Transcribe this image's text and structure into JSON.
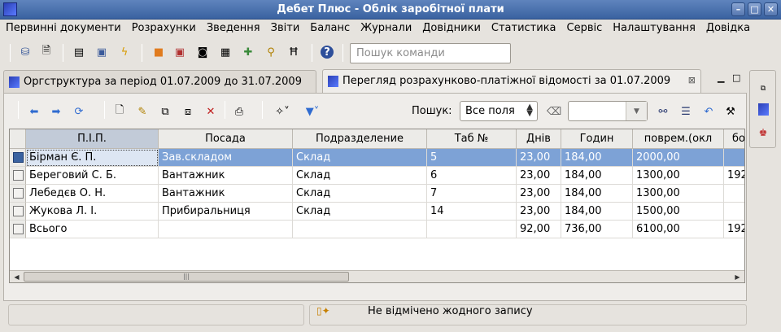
{
  "window": {
    "title": "Дебет Плюс - Облік заробітної плати",
    "controls": [
      "minimize-icon",
      "maximize-icon",
      "close-icon"
    ]
  },
  "menu": [
    "Первинні документи",
    "Розрахунки",
    "Зведення",
    "Звіти",
    "Баланс",
    "Журнали",
    "Довідники",
    "Статистика",
    "Сервіс",
    "Налаштування",
    "Довідка"
  ],
  "toolbar": {
    "command_search_placeholder": "Пошук команди",
    "icons": [
      "database-icon",
      "new-document-icon",
      "window-list-icon",
      "monitor-icon",
      "lightning-icon",
      "orange-square-icon",
      "person-card-icon",
      "camera-icon",
      "calendar-icon",
      "add-user-icon",
      "search-icon",
      "tools-icon",
      "help-icon"
    ]
  },
  "tabs": [
    {
      "label": "Оргструктура за період 01.07.2009 до 31.07.2009",
      "active": false
    },
    {
      "label": "Перегляд розрахунково-платіжної відомості за 01.07.2009",
      "active": true
    }
  ],
  "panel_toolbar": {
    "search_label": "Пошук:",
    "search_scope": "Все поля",
    "search_value": "",
    "icons": [
      "arrow-left-icon",
      "arrow-right-icon",
      "refresh-icon",
      "new-icon",
      "edit-icon",
      "copy-icon",
      "export-icon",
      "delete-icon",
      "print-icon",
      "wand-icon",
      "filter-icon",
      "eraser-icon",
      "binoculars-icon",
      "list-icon",
      "undo-icon",
      "hammer-icon"
    ]
  },
  "table": {
    "columns": [
      "П.І.П.",
      "Посада",
      "Подразделение",
      "Таб №",
      "Днів",
      "Годин",
      "поврем.(окл",
      "бо"
    ],
    "rows": [
      [
        "Бірман Є. П.",
        "Зав.складом",
        "Склад",
        "5",
        "23,00",
        "184,00",
        "2000,00",
        ""
      ],
      [
        "Береговий С. Б.",
        "Вантажник",
        "Склад",
        "6",
        "23,00",
        "184,00",
        "1300,00",
        "192"
      ],
      [
        "Лебедєв О. Н.",
        "Вантажник",
        "Склад",
        "7",
        "23,00",
        "184,00",
        "1300,00",
        ""
      ],
      [
        "Жукова Л. І.",
        "Прибиральниця",
        "Склад",
        "14",
        "23,00",
        "184,00",
        "1500,00",
        ""
      ],
      [
        "Всього",
        "",
        "",
        "",
        "92,00",
        "736,00",
        "6100,00",
        "192"
      ]
    ],
    "selected_row": 0
  },
  "status": {
    "message": "Не відмічено жодного запису"
  }
}
